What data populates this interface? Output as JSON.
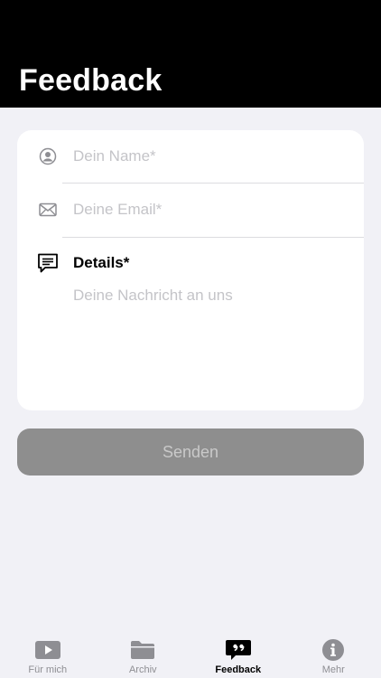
{
  "header": {
    "title": "Feedback"
  },
  "form": {
    "name_placeholder": "Dein Name*",
    "email_placeholder": "Deine Email*",
    "details_label": "Details*",
    "details_placeholder": "Deine Nachricht an uns",
    "submit_label": "Senden"
  },
  "tabbar": {
    "items": [
      {
        "label": "Für mich",
        "icon": "play-icon",
        "active": false
      },
      {
        "label": "Archiv",
        "icon": "folder-icon",
        "active": false
      },
      {
        "label": "Feedback",
        "icon": "quote-bubble-icon",
        "active": true
      },
      {
        "label": "Mehr",
        "icon": "info-icon",
        "active": false
      }
    ]
  }
}
